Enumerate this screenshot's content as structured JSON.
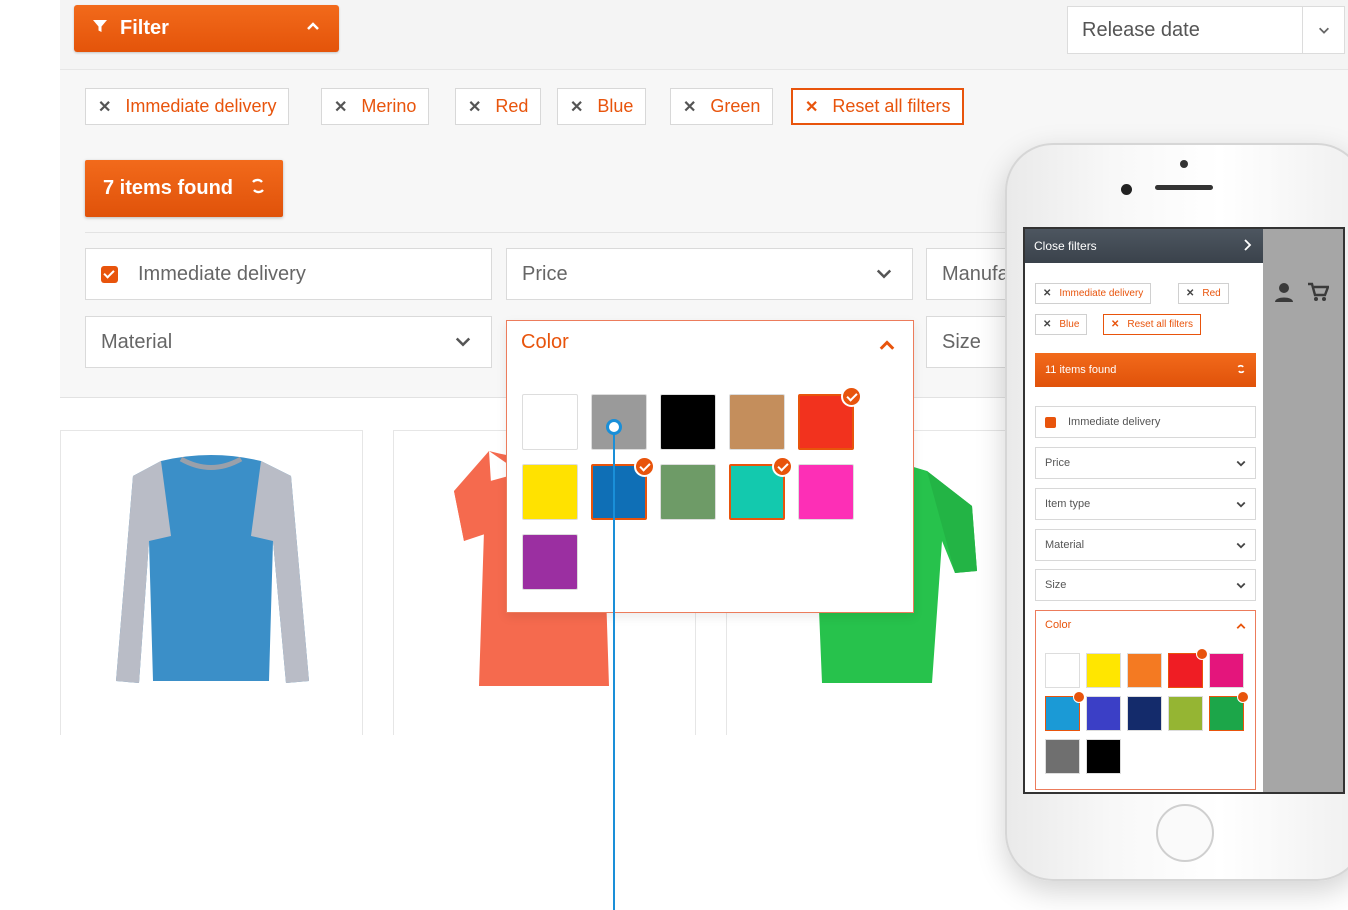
{
  "toolbar": {
    "filter_label": "Filter",
    "sort_value": "Release date"
  },
  "active_filters": [
    "Immediate delivery",
    "Merino",
    "Red",
    "Blue",
    "Green"
  ],
  "reset_label": "Reset all filters",
  "results": {
    "found_label": "7 items found"
  },
  "filters": {
    "immediate_delivery": "Immediate delivery",
    "price": "Price",
    "manufacturer": "Manufa",
    "material": "Material",
    "color": "Color",
    "size": "Size"
  },
  "color_swatches": [
    {
      "color": "#ffffff",
      "selected": false
    },
    {
      "color": "#9a9a9a",
      "selected": false
    },
    {
      "color": "#000000",
      "selected": false
    },
    {
      "color": "#c48e5c",
      "selected": false
    },
    {
      "color": "#f2321e",
      "selected": true
    },
    {
      "color": "#ffe200",
      "selected": false
    },
    {
      "color": "#0f6fb6",
      "selected": true
    },
    {
      "color": "#6e9b67",
      "selected": false
    },
    {
      "color": "#13c9ae",
      "selected": true
    },
    {
      "color": "#fd2fb6",
      "selected": false
    },
    {
      "color": "#9b2fa1",
      "selected": false
    }
  ],
  "mobile": {
    "close_label": "Close filters",
    "chips": [
      "Immediate delivery",
      "Red",
      "Blue"
    ],
    "reset_label": "Reset all filters",
    "found_label": "11 items found",
    "immediate_delivery": "Immediate delivery",
    "price": "Price",
    "item_type": "Item type",
    "material": "Material",
    "size": "Size",
    "color": "Color",
    "swatches": [
      {
        "color": "#ffffff",
        "selected": false
      },
      {
        "color": "#ffe600",
        "selected": false
      },
      {
        "color": "#f47a22",
        "selected": false
      },
      {
        "color": "#ef1d24",
        "selected": true
      },
      {
        "color": "#e4157c",
        "selected": false
      },
      {
        "color": "#1b9ad6",
        "selected": true
      },
      {
        "color": "#3b3fc6",
        "selected": false
      },
      {
        "color": "#142b6b",
        "selected": false
      },
      {
        "color": "#95b533",
        "selected": false
      },
      {
        "color": "#1ca649",
        "selected": true
      },
      {
        "color": "#6f6f6f",
        "selected": false
      },
      {
        "color": "#000000",
        "selected": false
      }
    ]
  },
  "accent_color": "#e8540c"
}
